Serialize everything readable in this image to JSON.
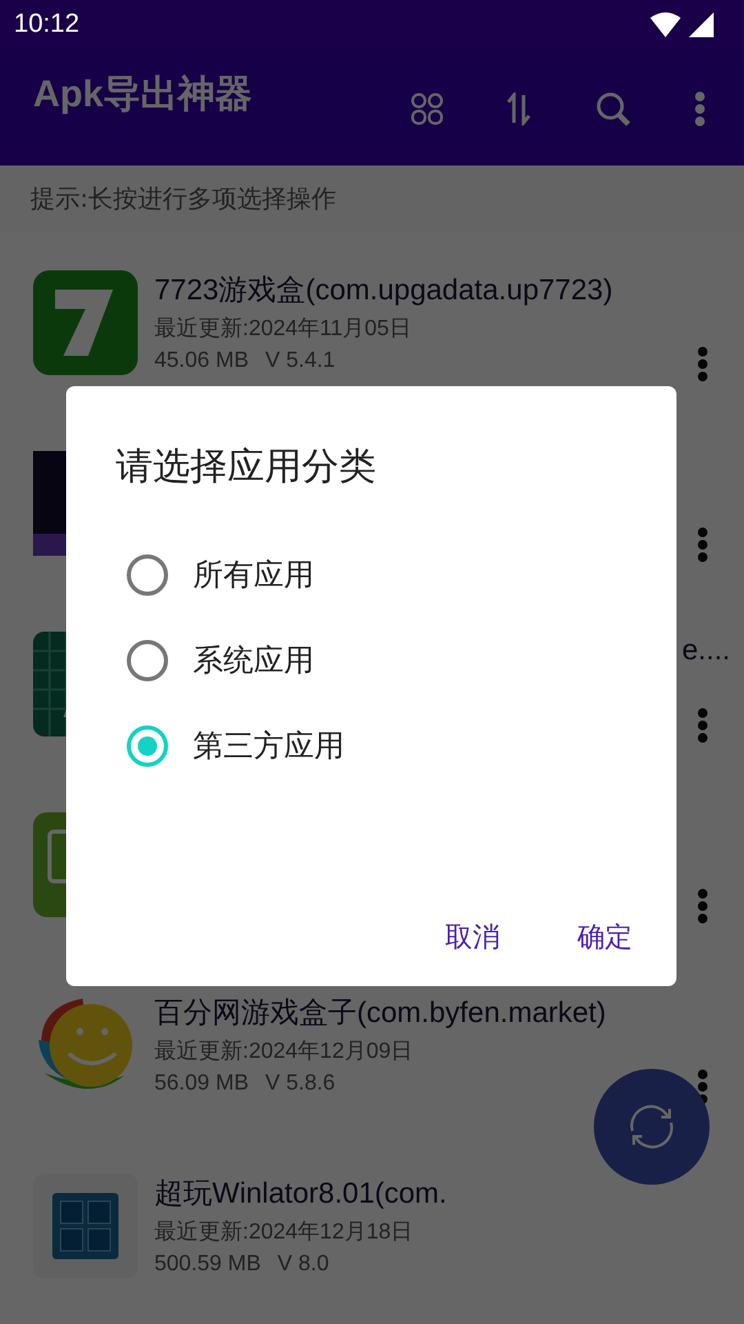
{
  "status_bar": {
    "time": "10:12"
  },
  "app_bar": {
    "title": "Apk导出神器"
  },
  "hint": "提示:长按进行多项选择操作",
  "apps": [
    {
      "kind": "full",
      "title": "7723游戏盒(com.upgadata.up7723)",
      "updated": "最近更新:2024年11月05日",
      "size": "45.06 MB",
      "version": "V 5.4.1",
      "menu": true
    },
    {
      "kind": "covered",
      "menu": true
    },
    {
      "kind": "covered",
      "title_tail": "e....",
      "menu": true
    },
    {
      "kind": "covered",
      "menu": true
    },
    {
      "kind": "full",
      "title": "百分网游戏盒子(com.byfen.market)",
      "updated": "最近更新:2024年12月09日",
      "size": "56.09 MB",
      "version": "V 5.8.6",
      "menu": true
    },
    {
      "kind": "full",
      "title": "超玩Winlator8.01(com.",
      "updated": "最近更新:2024年12月18日",
      "size": "500.59 MB",
      "version": "V 8.0",
      "menu": false
    }
  ],
  "dialog": {
    "title": "请选择应用分类",
    "options": [
      {
        "label": "所有应用",
        "selected": false
      },
      {
        "label": "系统应用",
        "selected": false
      },
      {
        "label": "第三方应用",
        "selected": true
      }
    ],
    "buttons": [
      "取消",
      "确定"
    ]
  }
}
